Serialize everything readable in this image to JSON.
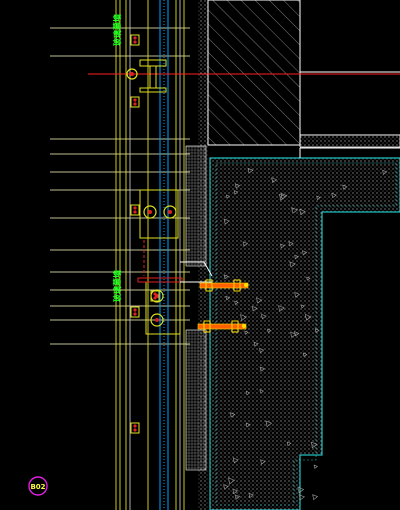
{
  "drawing": {
    "labels": {
      "upper_vertical": "玻璃幕墙",
      "lower_vertical": "玻璃幕墙"
    },
    "detail_marker": "B02"
  },
  "colors": {
    "background": "#000000",
    "structure_outline": "#ffffff",
    "concrete_outline": "#20c0c0",
    "hatch": "#b0b0b0",
    "frame": "#e0e020",
    "leader": "#ffffc0",
    "glass": "#00a0ff",
    "bolt": "#e02020",
    "anchor": "#ff6000",
    "label_green": "#20ff20",
    "marker_magenta": "#e020e0",
    "red_line": "#ff2020"
  }
}
